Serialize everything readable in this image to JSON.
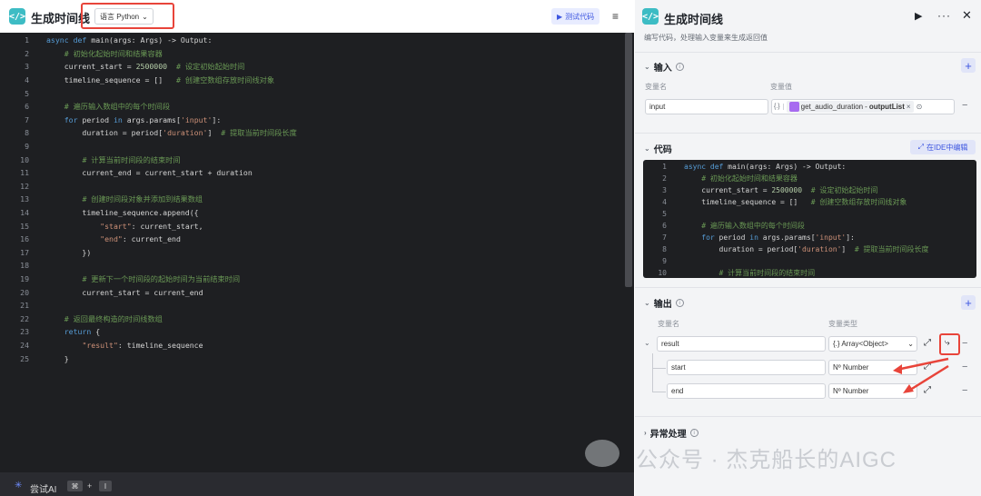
{
  "left": {
    "title": "生成时间线",
    "language_label": "语言 Python",
    "test_button": "测试代码",
    "footer_ai": "尝试AI",
    "footer_key1": "⌘",
    "footer_plus": "+",
    "footer_key2": "I"
  },
  "code_lines": [
    {
      "n": "1",
      "html": "<span class=\"kw\">async def</span> main(args: Args) -&gt; Output:"
    },
    {
      "n": "2",
      "html": "    <span class=\"cm\"># 初始化起始时间和结果容器</span>"
    },
    {
      "n": "3",
      "html": "    current_start = <span class=\"num\">2500000</span>  <span class=\"cm\"># 设定初始起始时间</span>"
    },
    {
      "n": "4",
      "html": "    timeline_sequence = []   <span class=\"cm\"># 创建空数组存放时间线对象</span>"
    },
    {
      "n": "5",
      "html": ""
    },
    {
      "n": "6",
      "html": "    <span class=\"cm\"># 遍历输入数组中的每个时间段</span>"
    },
    {
      "n": "7",
      "html": "    <span class=\"kw\">for</span> period <span class=\"kw\">in</span> args.params[<span class=\"str\">'input'</span>]:"
    },
    {
      "n": "8",
      "html": "        duration = period[<span class=\"str\">'duration'</span>]  <span class=\"cm\"># 提取当前时间段长度</span>"
    },
    {
      "n": "9",
      "html": ""
    },
    {
      "n": "10",
      "html": "        <span class=\"cm\"># 计算当前时间段的结束时间</span>"
    },
    {
      "n": "11",
      "html": "        current_end = current_start + duration"
    },
    {
      "n": "12",
      "html": ""
    },
    {
      "n": "13",
      "html": "        <span class=\"cm\"># 创建时间段对象并添加到结果数组</span>"
    },
    {
      "n": "14",
      "html": "        timeline_sequence.append({"
    },
    {
      "n": "15",
      "html": "            <span class=\"str\">\"start\"</span>: current_start,"
    },
    {
      "n": "16",
      "html": "            <span class=\"str\">\"end\"</span>: current_end"
    },
    {
      "n": "17",
      "html": "        })"
    },
    {
      "n": "18",
      "html": ""
    },
    {
      "n": "19",
      "html": "        <span class=\"cm\"># 更新下一个时间段的起始时间为当前结束时间</span>"
    },
    {
      "n": "20",
      "html": "        current_start = current_end"
    },
    {
      "n": "21",
      "html": ""
    },
    {
      "n": "22",
      "html": "    <span class=\"cm\"># 返回最终构造的时间线数组</span>"
    },
    {
      "n": "23",
      "html": "    <span class=\"kw\">return</span> {"
    },
    {
      "n": "24",
      "html": "        <span class=\"str\">\"result\"</span>: timeline_sequence"
    },
    {
      "n": "25",
      "html": "    }"
    }
  ],
  "right": {
    "title": "生成时间线",
    "description": "编写代码，处理输入变量来生成返回值",
    "input_section": "输入",
    "col_var_name": "变量名",
    "col_var_value": "变量值",
    "input_name": "input",
    "input_ref_prefix": "{.}",
    "input_ref_node": "get_audio_duration",
    "input_ref_sep": " - ",
    "input_ref_field": "outputList",
    "code_section": "代码",
    "ide_button": "在IDE中编辑",
    "output_section": "输出",
    "col_out_name": "变量名",
    "col_out_type": "变量类型",
    "out_result_name": "result",
    "out_result_type": "{.} Array<Object>",
    "out_start_name": "start",
    "out_start_type": "Nº Number",
    "out_end_name": "end",
    "out_end_type": "Nº Number",
    "error_section": "异常处理"
  },
  "watermark": "公众号 · 杰克船长的AIGC",
  "colors": {
    "accent": "#3d56e0",
    "highlight": "#e8443a",
    "logo": "#3dbcc4"
  }
}
